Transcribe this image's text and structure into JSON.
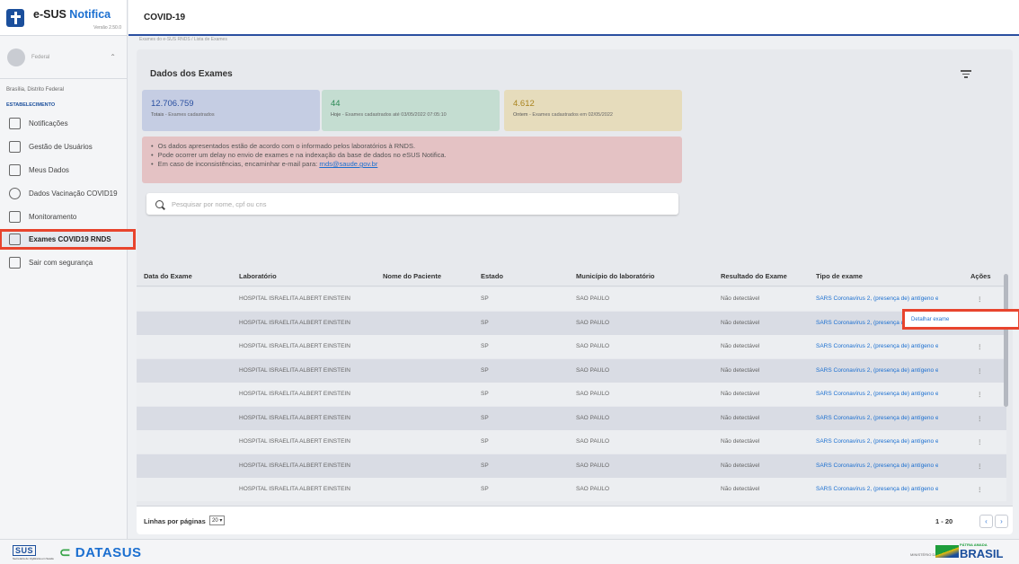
{
  "app": {
    "brand_prefix": "e-SUS ",
    "brand_highlight": "Notifica",
    "version": "Versão 2.50.0"
  },
  "user": {
    "name": "Federal",
    "location": "Brasília, Distrito Federal",
    "section_label": "ESTABELECIMENTO"
  },
  "sidebar": {
    "items": [
      {
        "label": "Notificações",
        "icon": "notification-icon"
      },
      {
        "label": "Gestão de Usuários",
        "icon": "users-icon"
      },
      {
        "label": "Meus Dados",
        "icon": "chart-icon"
      },
      {
        "label": "Dados Vacinação COVID19",
        "icon": "vaccine-icon"
      },
      {
        "label": "Monitoramento",
        "icon": "monitor-icon"
      },
      {
        "label": "Exames COVID19 RNDS",
        "icon": "exam-icon",
        "active": true
      },
      {
        "label": "Sair com segurança",
        "icon": "logout-icon"
      }
    ]
  },
  "header": {
    "title": "COVID-19",
    "breadcrumb": "Exames do e-SUS RNDS / Lista de Exames"
  },
  "main": {
    "title": "Dados dos Exames",
    "stats": [
      {
        "value": "12.706.759",
        "label": "Totais",
        "desc": " - Exames cadastrados"
      },
      {
        "value": "44",
        "label": "Hoje",
        "desc": " - Exames cadastrados até 03/05/2022 07:05:10"
      },
      {
        "value": "4.612",
        "label": "Ontem",
        "desc": " - Exames cadastrados em 02/05/2022"
      }
    ],
    "notices": [
      "Os dados apresentados estão de acordo com o informado pelos laboratórios à RNDS.",
      "Pode ocorrer um delay no envio de exames e na indexação da base de dados no eSUS Notifica.",
      "Em caso de inconsistências, encaminhar e-mail para: "
    ],
    "notice_email": "rnds@saude.gov.br",
    "search_placeholder": "Pesquisar por nome, cpf ou cns"
  },
  "table": {
    "columns": [
      "Data do Exame",
      "Laboratório",
      "Nome do Paciente",
      "Estado",
      "Município do laboratório",
      "Resultado do Exame",
      "Tipo de exame",
      "Ações"
    ],
    "rows": [
      {
        "date": "",
        "lab": "HOSPITAL ISRAELITA ALBERT EINSTEIN",
        "patient": "",
        "state": "SP",
        "city": "SAO PAULO",
        "result": "Não detectável",
        "type": "SARS Coronavírus 2, (presença de) antígeno em"
      },
      {
        "date": "",
        "lab": "HOSPITAL ISRAELITA ALBERT EINSTEIN",
        "patient": "",
        "state": "SP",
        "city": "SAO PAULO",
        "result": "Não detectável",
        "type": "SARS Coronavírus 2, (presença de) antígeno em"
      },
      {
        "date": "",
        "lab": "HOSPITAL ISRAELITA ALBERT EINSTEIN",
        "patient": "",
        "state": "SP",
        "city": "SAO PAULO",
        "result": "Não detectável",
        "type": "SARS Coronavírus 2, (presença de) antígeno em"
      },
      {
        "date": "",
        "lab": "HOSPITAL ISRAELITA ALBERT EINSTEIN",
        "patient": "",
        "state": "SP",
        "city": "SAO PAULO",
        "result": "Não detectável",
        "type": "SARS Coronavírus 2, (presença de) antígeno em"
      },
      {
        "date": "",
        "lab": "HOSPITAL ISRAELITA ALBERT EINSTEIN",
        "patient": "",
        "state": "SP",
        "city": "SAO PAULO",
        "result": "Não detectável",
        "type": "SARS Coronavírus 2, (presença de) antígeno em"
      },
      {
        "date": "",
        "lab": "HOSPITAL ISRAELITA ALBERT EINSTEIN",
        "patient": "",
        "state": "SP",
        "city": "SAO PAULO",
        "result": "Não detectável",
        "type": "SARS Coronavírus 2, (presença de) antígeno em"
      },
      {
        "date": "",
        "lab": "HOSPITAL ISRAELITA ALBERT EINSTEIN",
        "patient": "",
        "state": "SP",
        "city": "SAO PAULO",
        "result": "Não detectável",
        "type": "SARS Coronavírus 2, (presença de) antígeno em"
      },
      {
        "date": "",
        "lab": "HOSPITAL ISRAELITA ALBERT EINSTEIN",
        "patient": "",
        "state": "SP",
        "city": "SAO PAULO",
        "result": "Não detectável",
        "type": "SARS Coronavírus 2, (presença de) antígeno em"
      },
      {
        "date": "",
        "lab": "HOSPITAL ISRAELITA ALBERT EINSTEIN",
        "patient": "",
        "state": "SP",
        "city": "SAO PAULO",
        "result": "Não detectável",
        "type": "SARS Coronavírus 2, (presença de) antígeno em"
      }
    ],
    "action_glyph": "⋮",
    "popup_label": "Detalhar exame"
  },
  "pagination": {
    "rows_label": "Linhas por páginas",
    "rows_value": "20",
    "range": "1 - 20",
    "prev": "‹",
    "next": "›"
  },
  "footer": {
    "sus_logo": "SUS",
    "sus_sub": "Secretaria de Vigilância em Saúde",
    "datasus": "DATASUS",
    "ministerio": "MINISTÉRIO DA SAÚDE",
    "patria": "PÁTRIA AMADA",
    "brasil": "BRASIL"
  },
  "colors": {
    "accent": "#1b4f9c",
    "highlight": "#e8442d",
    "link": "#1b6fd0"
  }
}
